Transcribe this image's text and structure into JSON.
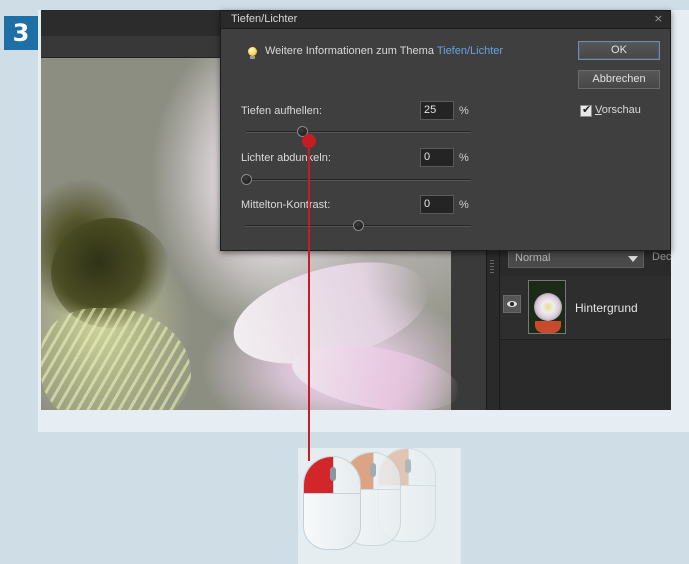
{
  "step": {
    "number": "3"
  },
  "dialog": {
    "title": "Tiefen/Lichter",
    "close_glyph": "×",
    "info_prefix": "Weitere Informationen zum Thema",
    "info_link": "Tiefen/Lichter",
    "ok_label": "OK",
    "cancel_label": "Abbrechen",
    "preview": {
      "label_first": "V",
      "label_rest": "orschau",
      "checked": true,
      "check_glyph": "✔"
    },
    "params": [
      {
        "label": "Tiefen aufhellen:",
        "value": "25",
        "unit": "%",
        "slider_fraction": 0.25
      },
      {
        "label": "Lichter abdunkeln:",
        "value": "0",
        "unit": "%",
        "slider_fraction": 0.0
      },
      {
        "label": "Mittelton-Kontrast:",
        "value": "0",
        "unit": "%",
        "slider_fraction": 0.5
      }
    ]
  },
  "layers_panel": {
    "blend_mode": "Normal",
    "opacity_label_cut": "Dec",
    "layers": [
      {
        "name": "Hintergrund",
        "visible": true
      }
    ]
  },
  "colors": {
    "accent_red": "#c41e24",
    "step_badge_blue": "#1d6fa6",
    "link_blue": "#66a3e0",
    "dialog_bg": "#3f3f3f"
  },
  "icons": {
    "tip": "lightbulb-icon",
    "eye": "eye-icon",
    "blend_dropdown": "chevron-down-icon",
    "mouse": "mouse-icon"
  }
}
